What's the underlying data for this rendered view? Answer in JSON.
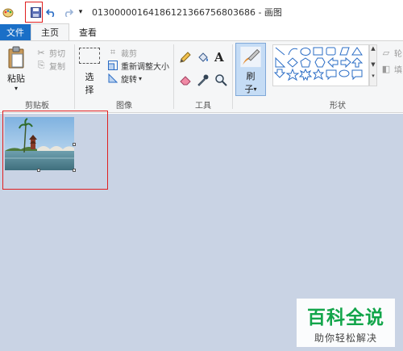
{
  "window": {
    "title": "013000001641861213667568036​86 - 画图",
    "quick_access": {
      "save_icon": "save-icon",
      "undo_icon": "undo-icon",
      "redo_icon": "redo-icon",
      "customize_icon": "customize-qa-icon"
    }
  },
  "tabs": [
    {
      "label": "文件"
    },
    {
      "label": "主页"
    },
    {
      "label": "查看"
    }
  ],
  "ribbon": {
    "clipboard": {
      "paste_label": "粘贴",
      "cut_label": "剪切",
      "copy_label": "复制",
      "group_label": "剪贴板"
    },
    "image": {
      "select_label_line1": "选",
      "select_label_line2": "择",
      "crop_label": "裁剪",
      "resize_label": "重新调整大小",
      "rotate_label": "旋转",
      "group_label": "图像"
    },
    "tools": {
      "text_glyph": "A",
      "group_label": "工具"
    },
    "brushes": {
      "label_line1": "刷",
      "label_line2": "子"
    },
    "shapes": {
      "group_label": "形状",
      "outline_label": "轮",
      "fill_label": "填"
    }
  },
  "watermark": {
    "title": "百科全说",
    "subtitle": "助你轻松解决"
  },
  "colors": {
    "accent": "#1a6fc7",
    "highlight_box": "#e02020",
    "workspace": "#c9d3e4",
    "watermark_green": "#12a54a"
  }
}
